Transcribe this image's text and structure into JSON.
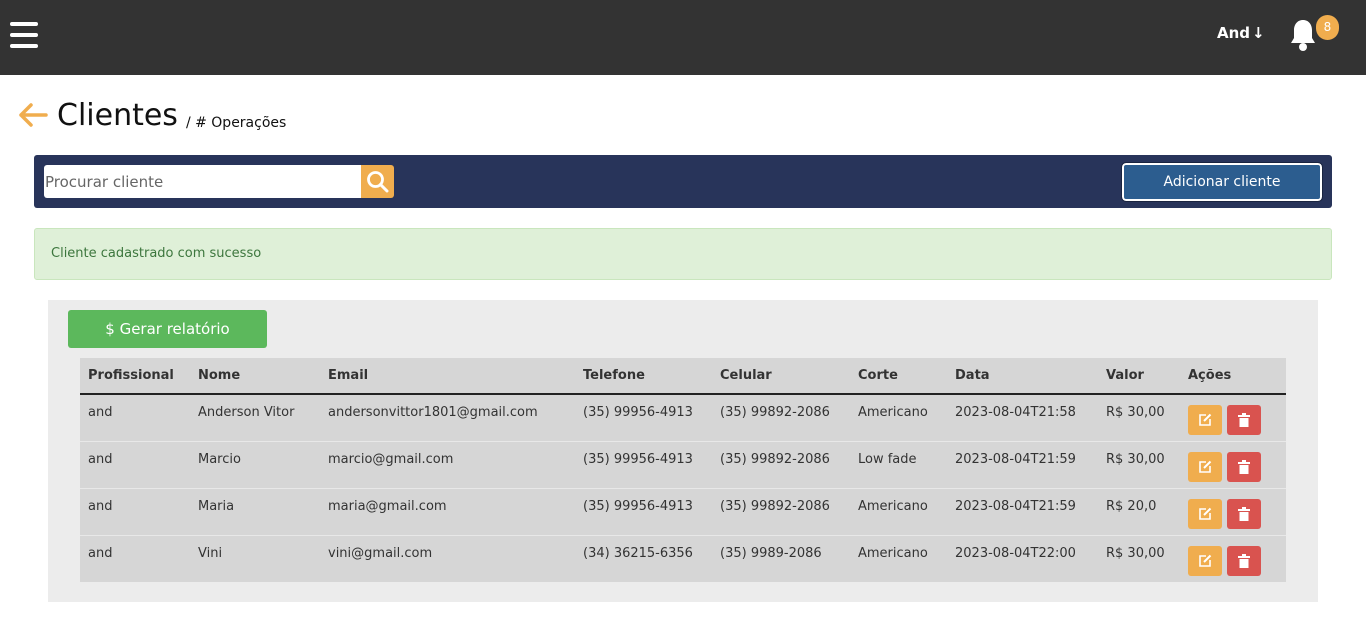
{
  "header": {
    "user_label": "And",
    "user_arrow": "↓",
    "notification_count": "8"
  },
  "page": {
    "title": "Clientes",
    "breadcrumb": "/ # Operações"
  },
  "toolbar": {
    "search_placeholder": "Procurar cliente",
    "add_label": "Adicionar cliente"
  },
  "alert": {
    "message": "Cliente cadastrado com sucesso"
  },
  "report": {
    "label": "$ Gerar relatório"
  },
  "table": {
    "headers": {
      "profissional": "Profissional",
      "nome": "Nome",
      "email": "Email",
      "telefone": "Telefone",
      "celular": "Celular",
      "corte": "Corte",
      "data": "Data",
      "valor": "Valor",
      "acoes": "Ações"
    },
    "rows": [
      {
        "profissional": "and",
        "nome": "Anderson Vitor",
        "email": "andersonvittor1801@gmail.com",
        "telefone": "(35) 99956-4913",
        "celular": "(35) 99892-2086",
        "corte": "Americano",
        "data": "2023-08-04T21:58",
        "valor": "R$ 30,00"
      },
      {
        "profissional": "and",
        "nome": "Marcio",
        "email": "marcio@gmail.com",
        "telefone": "(35) 99956-4913",
        "celular": "(35) 99892-2086",
        "corte": "Low fade",
        "data": "2023-08-04T21:59",
        "valor": "R$ 30,00"
      },
      {
        "profissional": "and",
        "nome": "Maria",
        "email": "maria@gmail.com",
        "telefone": "(35) 99956-4913",
        "celular": "(35) 99892-2086",
        "corte": "Americano",
        "data": "2023-08-04T21:59",
        "valor": "R$ 20,0"
      },
      {
        "profissional": "and",
        "nome": "Vini",
        "email": "vini@gmail.com",
        "telefone": "(34) 36215-6356",
        "celular": "(35) 9989-2086",
        "corte": "Americano",
        "data": "2023-08-04T22:00",
        "valor": "R$ 30,00"
      }
    ]
  },
  "colors": {
    "topbar": "#333333",
    "toolbar": "#28345a",
    "accent": "#f0ad4e",
    "add_button": "#2c5d8f",
    "success": "#5cb85c",
    "danger": "#d9534f"
  },
  "icons": [
    "hamburger-icon",
    "bell-icon",
    "back-arrow-icon",
    "search-icon",
    "edit-icon",
    "trash-icon"
  ]
}
